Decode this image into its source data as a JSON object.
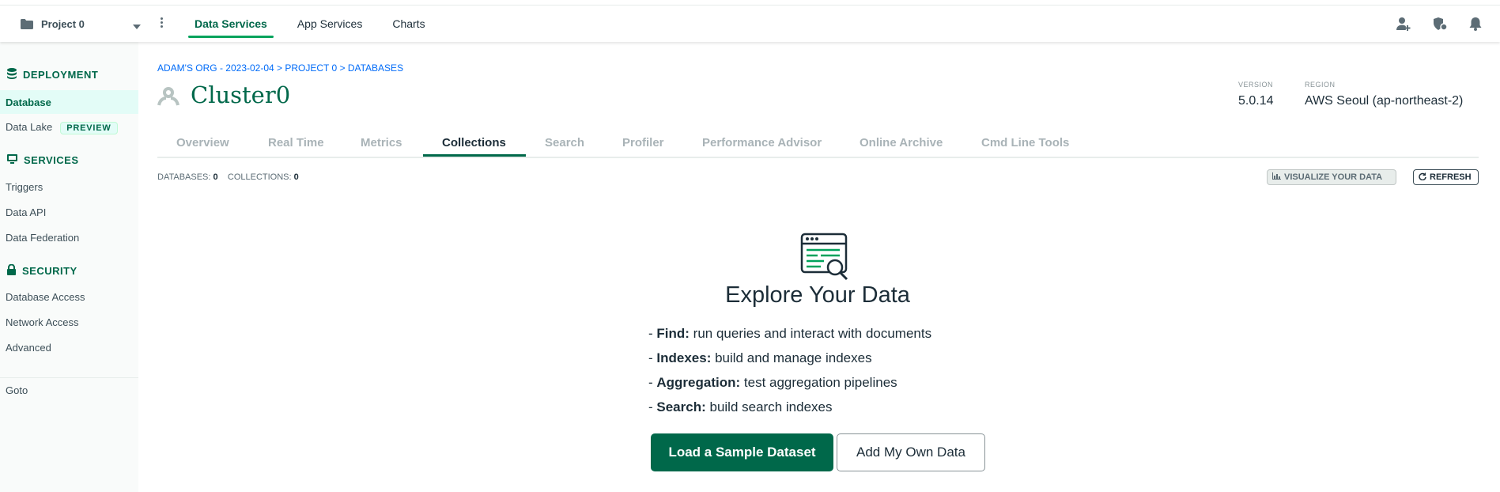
{
  "topbar": {
    "project_name": "Project 0",
    "tabs": [
      {
        "label": "Data Services",
        "active": true
      },
      {
        "label": "App Services",
        "active": false
      },
      {
        "label": "Charts",
        "active": false
      }
    ],
    "icons": [
      "add-user-icon",
      "secure-icon",
      "notification-bell-icon"
    ]
  },
  "sidebar": {
    "deployment": {
      "heading": "DEPLOYMENT",
      "icon": "database-icon",
      "items": [
        {
          "label": "Database",
          "active": true
        },
        {
          "label": "Data Lake",
          "badge": "PREVIEW"
        }
      ]
    },
    "services": {
      "heading": "SERVICES",
      "icon": "monitor-icon",
      "items": [
        {
          "label": "Triggers"
        },
        {
          "label": "Data API"
        },
        {
          "label": "Data Federation"
        }
      ]
    },
    "security": {
      "heading": "SECURITY",
      "icon": "lock-icon",
      "items": [
        {
          "label": "Database Access"
        },
        {
          "label": "Network Access"
        },
        {
          "label": "Advanced"
        }
      ]
    },
    "goto": "Goto"
  },
  "main": {
    "breadcrumb": "ADAM'S ORG - 2023-02-04 > PROJECT 0 > DATABASES",
    "cluster_name": "Cluster0",
    "version_label": "VERSION",
    "version": "5.0.14",
    "region_label": "REGION",
    "region": "AWS Seoul (ap-northeast-2)",
    "tabs": [
      {
        "label": "Overview"
      },
      {
        "label": "Real Time"
      },
      {
        "label": "Metrics"
      },
      {
        "label": "Collections",
        "active": true
      },
      {
        "label": "Search"
      },
      {
        "label": "Profiler"
      },
      {
        "label": "Performance Advisor"
      },
      {
        "label": "Online Archive"
      },
      {
        "label": "Cmd Line Tools"
      }
    ],
    "databases_label": "DATABASES:",
    "databases_count": "0",
    "collections_label": "COLLECTIONS:",
    "collections_count": "0",
    "visualize_label": "VISUALIZE YOUR DATA",
    "refresh_label": "REFRESH",
    "explore": {
      "title": "Explore Your Data",
      "features": [
        {
          "name": "Find:",
          "desc": " run queries and interact with documents"
        },
        {
          "name": "Indexes:",
          "desc": " build and manage indexes"
        },
        {
          "name": "Aggregation:",
          "desc": " test aggregation pipelines"
        },
        {
          "name": "Search:",
          "desc": " build search indexes"
        }
      ],
      "primary_button": "Load a Sample Dataset",
      "secondary_button": "Add My Own Data"
    }
  },
  "colors": {
    "brand_green": "#00684a",
    "accent_green": "#00a35c",
    "link_blue": "#016bf8"
  }
}
